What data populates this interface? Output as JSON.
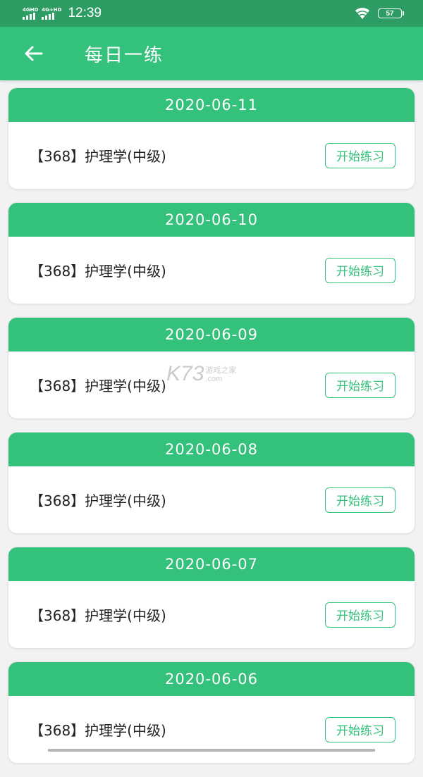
{
  "status": {
    "sim1": "4GHD",
    "sim2": "4G+HD",
    "time": "12:39",
    "battery": "57"
  },
  "header": {
    "title": "每日一练",
    "back_icon": "arrow-left-icon"
  },
  "colors": {
    "primary": "#34c17b",
    "status_bar": "#2e9d63",
    "background": "#f2f2f2"
  },
  "items": [
    {
      "date": "2020-06-11",
      "title": "【368】护理学(中级)",
      "button": "开始练习"
    },
    {
      "date": "2020-06-10",
      "title": "【368】护理学(中级)",
      "button": "开始练习"
    },
    {
      "date": "2020-06-09",
      "title": "【368】护理学(中级)",
      "button": "开始练习"
    },
    {
      "date": "2020-06-08",
      "title": "【368】护理学(中级)",
      "button": "开始练习"
    },
    {
      "date": "2020-06-07",
      "title": "【368】护理学(中级)",
      "button": "开始练习"
    },
    {
      "date": "2020-06-06",
      "title": "【368】护理学(中级)",
      "button": "开始练习"
    }
  ],
  "watermark": {
    "logo": "K73",
    "text_top": "游戏之家",
    "text_bottom": ".com"
  }
}
